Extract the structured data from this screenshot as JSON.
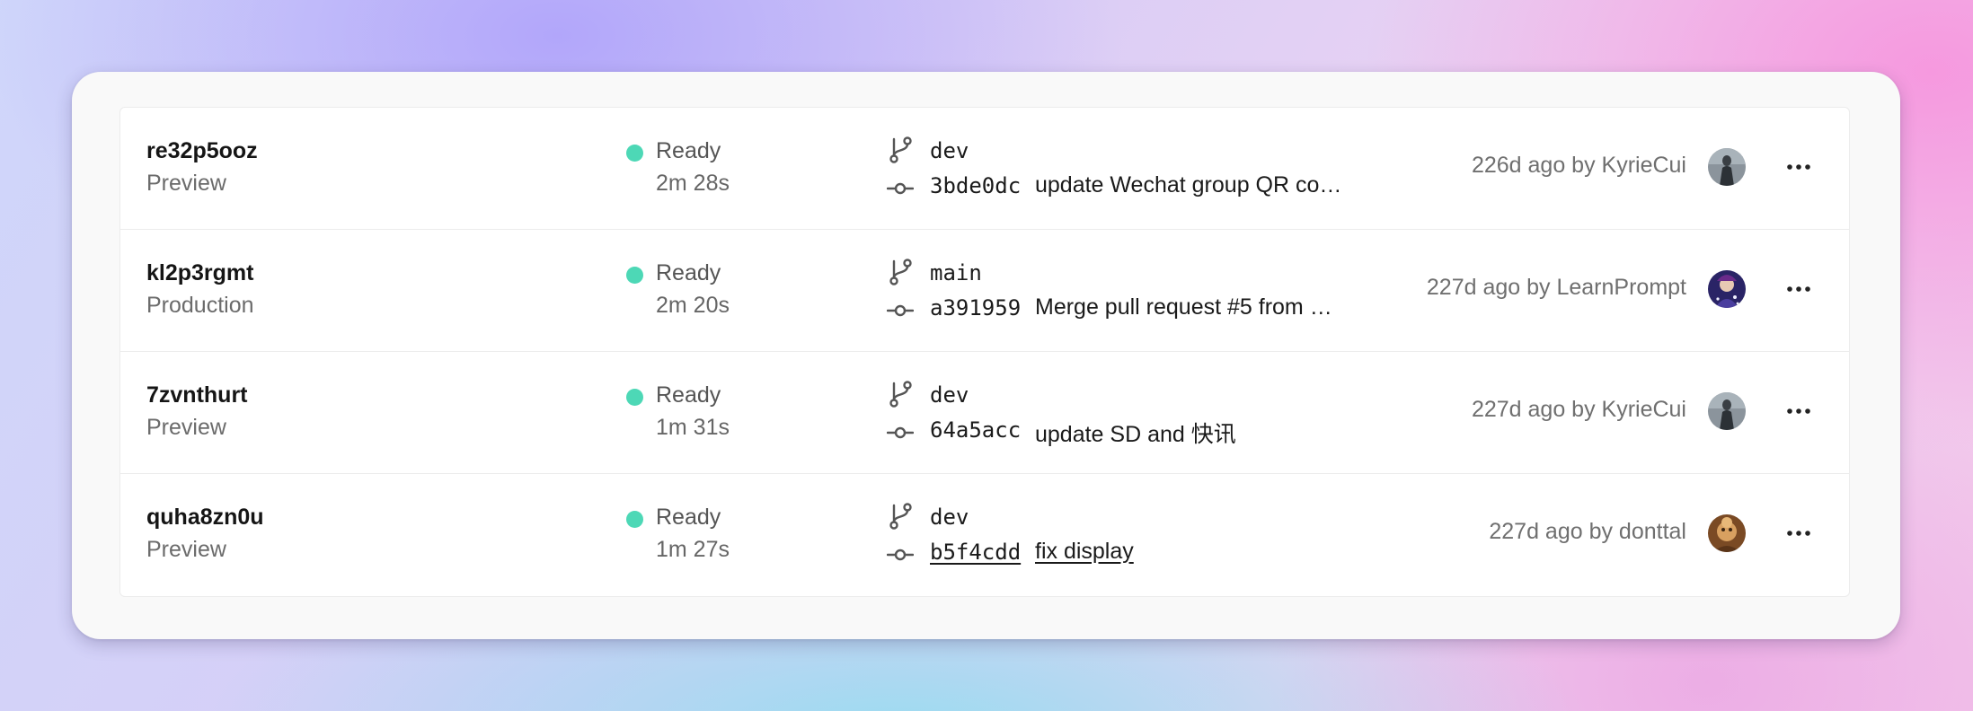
{
  "colors": {
    "ready": "#4dd8b6",
    "text": "#151515",
    "muted": "#6f6f6f"
  },
  "icons": {
    "branch": "git-branch-icon",
    "commit": "git-commit-icon",
    "more": "more-horizontal-icon"
  },
  "deployments": [
    {
      "id": "re32p5ooz",
      "environment": "Preview",
      "status": "Ready",
      "duration": "2m 28s",
      "branch": "dev",
      "commit_hash": "3bde0dc",
      "commit_message": "update Wechat group QR co…",
      "meta": "226d ago by KyrieCui",
      "avatar_alt": "KyrieCui"
    },
    {
      "id": "kl2p3rgmt",
      "environment": "Production",
      "status": "Ready",
      "duration": "2m 20s",
      "branch": "main",
      "commit_hash": "a391959",
      "commit_message": "Merge pull request #5 from …",
      "meta": "227d ago by LearnPrompt",
      "avatar_alt": "LearnPrompt"
    },
    {
      "id": "7zvnthurt",
      "environment": "Preview",
      "status": "Ready",
      "duration": "1m 31s",
      "branch": "dev",
      "commit_hash": "64a5acc",
      "commit_message": "update SD and 快讯",
      "meta": "227d ago by KyrieCui",
      "avatar_alt": "KyrieCui"
    },
    {
      "id": "quha8zn0u",
      "environment": "Preview",
      "status": "Ready",
      "duration": "1m 27s",
      "branch": "dev",
      "commit_hash": "b5f4cdd",
      "commit_message": "fix display",
      "meta": "227d ago by donttal",
      "avatar_alt": "donttal"
    }
  ]
}
